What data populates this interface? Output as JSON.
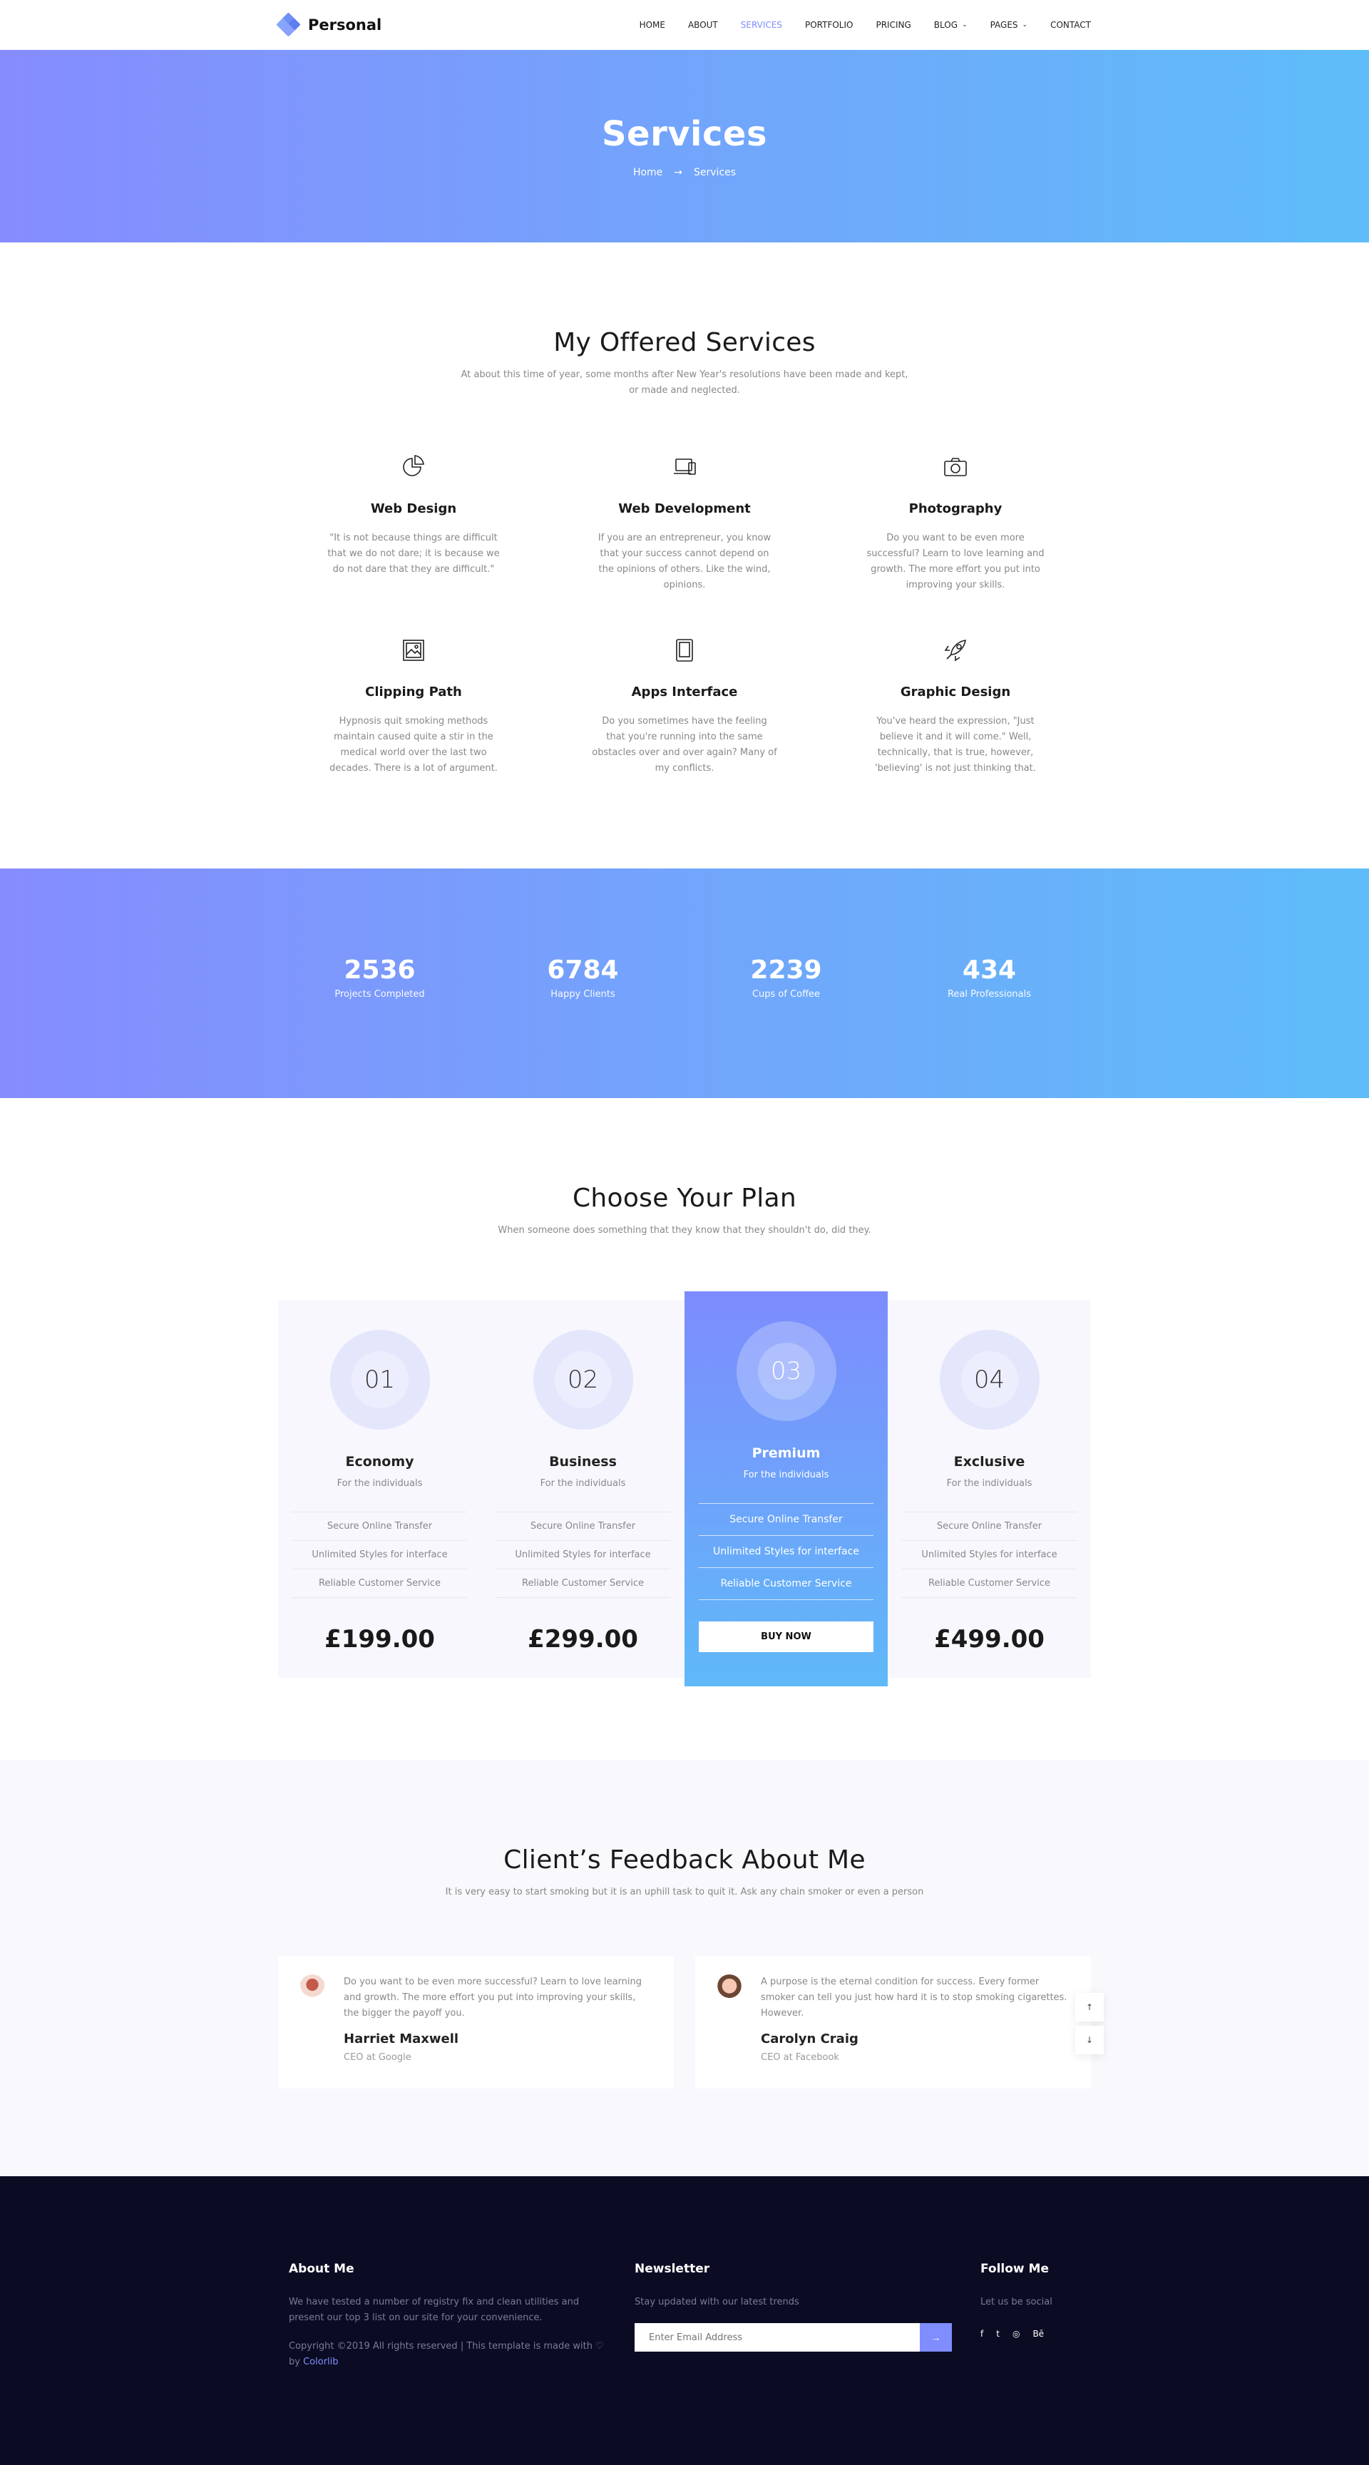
{
  "header": {
    "brand": "Personal",
    "nav": [
      {
        "label": "HOME"
      },
      {
        "label": "ABOUT"
      },
      {
        "label": "SERVICES"
      },
      {
        "label": "PORTFOLIO"
      },
      {
        "label": "PRICING"
      },
      {
        "label": "BLOG"
      },
      {
        "label": "PAGES"
      },
      {
        "label": "CONTACT"
      }
    ]
  },
  "hero": {
    "title": "Services",
    "breadcrumb": {
      "home": "Home",
      "arrow": "→",
      "current": "Services"
    }
  },
  "services": {
    "title": "My Offered Services",
    "subtitle": "At about this time of year, some months after New Year's resolutions have been made and kept, or made and neglected.",
    "items": [
      {
        "title": "Web Design",
        "text": "\"It is not because things are difficult that we do not dare; it is because we do not dare that they are difficult.\""
      },
      {
        "title": "Web Development",
        "text": "If you are an entrepreneur, you know that your success cannot depend on the opinions of others. Like the wind, opinions."
      },
      {
        "title": "Photography",
        "text": "Do you want to be even more successful? Learn to love learning and growth. The more effort you put into improving your skills."
      },
      {
        "title": "Clipping Path",
        "text": "Hypnosis quit smoking methods maintain caused quite a stir in the medical world over the last two decades. There is a lot of argument."
      },
      {
        "title": "Apps Interface",
        "text": "Do you sometimes have the feeling that you're running into the same obstacles over and over again? Many of my conflicts."
      },
      {
        "title": "Graphic Design",
        "text": "You've heard the expression, \"Just believe it and it will come.\" Well, technically, that is true, however, 'believing' is not just thinking that."
      }
    ]
  },
  "stats": [
    {
      "value": "2536",
      "label": "Projects Completed"
    },
    {
      "value": "6784",
      "label": "Happy Clients"
    },
    {
      "value": "2239",
      "label": "Cups of Coffee"
    },
    {
      "value": "434",
      "label": "Real Professionals"
    }
  ],
  "pricing": {
    "title": "Choose Your Plan",
    "subtitle": "When someone does something that they know that they shouldn't do, did they.",
    "plans": [
      {
        "num": "01",
        "name": "Economy",
        "sub": "For the individuals",
        "features": [
          "Secure Online Transfer",
          "Unlimited Styles for interface",
          "Reliable Customer Service"
        ],
        "price": "£199.00"
      },
      {
        "num": "02",
        "name": "Business",
        "sub": "For the individuals",
        "features": [
          "Secure Online Transfer",
          "Unlimited Styles for interface",
          "Reliable Customer Service"
        ],
        "price": "£299.00"
      },
      {
        "num": "03",
        "name": "Premium",
        "sub": "For the individuals",
        "features": [
          "Secure Online Transfer",
          "Unlimited Styles for interface",
          "Reliable Customer Service"
        ],
        "button": "BUY NOW"
      },
      {
        "num": "04",
        "name": "Exclusive",
        "sub": "For the individuals",
        "features": [
          "Secure Online Transfer",
          "Unlimited Styles for interface",
          "Reliable Customer Service"
        ],
        "price": "£499.00"
      }
    ]
  },
  "feedback": {
    "title": "Client’s Feedback About Me",
    "subtitle": "It is very easy to start smoking but it is an uphill task to quit it. Ask any chain smoker or even a person",
    "reviews": [
      {
        "quote": "Do you want to be even more successful? Learn to love learning and growth. The more effort you put into improving your skills, the bigger the payoff you.",
        "name": "Harriet Maxwell",
        "role": "CEO at Google"
      },
      {
        "quote": "A purpose is the eternal condition for success. Every former smoker can tell you just how hard it is to stop smoking cigarettes. However.",
        "name": "Carolyn Craig",
        "role": "CEO at Facebook"
      }
    ],
    "nav": {
      "up": "↑",
      "down": "↓"
    }
  },
  "footer": {
    "about": {
      "title": "About Me",
      "text": "We have tested a number of registry fix and clean utilities and present our top 3 list on our site for your convenience.",
      "copyright": "Copyright ©2019 All rights reserved | This template is made with",
      "heart": "♡",
      "by": "by",
      "link": "Colorlib"
    },
    "newsletter": {
      "title": "Newsletter",
      "text": "Stay updated with our latest trends",
      "placeholder": "Enter Email Address",
      "button": "→"
    },
    "follow": {
      "title": "Follow Me",
      "text": "Let us be social",
      "icons": [
        "f",
        "t",
        "◎",
        "Bē"
      ]
    }
  }
}
